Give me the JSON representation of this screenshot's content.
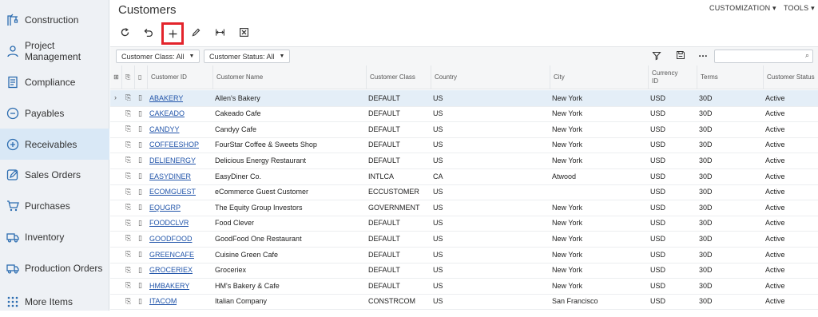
{
  "sidebar": {
    "items": [
      {
        "label": "Construction",
        "icon": "crane-icon",
        "active": false
      },
      {
        "label": "Project Management",
        "icon": "person-icon",
        "active": false
      },
      {
        "label": "Compliance",
        "icon": "document-icon",
        "active": false
      },
      {
        "label": "Payables",
        "icon": "minus-circle-icon",
        "active": false
      },
      {
        "label": "Receivables",
        "icon": "plus-circle-icon",
        "active": true
      },
      {
        "label": "Sales Orders",
        "icon": "pencil-box-icon",
        "active": false
      },
      {
        "label": "Purchases",
        "icon": "cart-icon",
        "active": false
      },
      {
        "label": "Inventory",
        "icon": "truck-icon",
        "active": false
      },
      {
        "label": "Production Orders",
        "icon": "truck-icon",
        "active": false
      },
      {
        "label": "More Items",
        "icon": "grid-dots-icon",
        "active": false
      }
    ]
  },
  "header": {
    "title": "Customers",
    "customization": "CUSTOMIZATION",
    "tools": "TOOLS"
  },
  "filters": {
    "customer_class": "Customer Class: All",
    "customer_status": "Customer Status: All",
    "search_placeholder": ""
  },
  "grid": {
    "columns": [
      "Customer ID",
      "Customer Name",
      "Customer Class",
      "Country",
      "City",
      "Currency ID",
      "Terms",
      "Customer Status"
    ],
    "rows": [
      [
        "ABAKERY",
        "Allen's Bakery",
        "DEFAULT",
        "US",
        "New York",
        "USD",
        "30D",
        "Active"
      ],
      [
        "CAKEADO",
        "Cakeado Cafe",
        "DEFAULT",
        "US",
        "New York",
        "USD",
        "30D",
        "Active"
      ],
      [
        "CANDYY",
        "Candyy Cafe",
        "DEFAULT",
        "US",
        "New York",
        "USD",
        "30D",
        "Active"
      ],
      [
        "COFFEESHOP",
        "FourStar Coffee & Sweets Shop",
        "DEFAULT",
        "US",
        "New York",
        "USD",
        "30D",
        "Active"
      ],
      [
        "DELIENERGY",
        "Delicious Energy Restaurant",
        "DEFAULT",
        "US",
        "New York",
        "USD",
        "30D",
        "Active"
      ],
      [
        "EASYDINER",
        "EasyDiner Co.",
        "INTLCA",
        "CA",
        "Atwood",
        "USD",
        "30D",
        "Active"
      ],
      [
        "ECOMGUEST",
        "eCommerce Guest Customer",
        "ECCUSTOMER",
        "US",
        "",
        "USD",
        "30D",
        "Active"
      ],
      [
        "EQUGRP",
        "The Equity Group Investors",
        "GOVERNMENT",
        "US",
        "New York",
        "USD",
        "30D",
        "Active"
      ],
      [
        "FOODCLVR",
        "Food Clever",
        "DEFAULT",
        "US",
        "New York",
        "USD",
        "30D",
        "Active"
      ],
      [
        "GOODFOOD",
        "GoodFood One Restaurant",
        "DEFAULT",
        "US",
        "New York",
        "USD",
        "30D",
        "Active"
      ],
      [
        "GREENCAFE",
        "Cuisine Green Cafe",
        "DEFAULT",
        "US",
        "New York",
        "USD",
        "30D",
        "Active"
      ],
      [
        "GROCERIEX",
        "Groceriex",
        "DEFAULT",
        "US",
        "New York",
        "USD",
        "30D",
        "Active"
      ],
      [
        "HMBAKERY",
        "HM's Bakery & Cafe",
        "DEFAULT",
        "US",
        "New York",
        "USD",
        "30D",
        "Active"
      ],
      [
        "ITACOM",
        "Italian Company",
        "CONSTRCOM",
        "US",
        "San Francisco",
        "USD",
        "30D",
        "Active"
      ]
    ]
  }
}
